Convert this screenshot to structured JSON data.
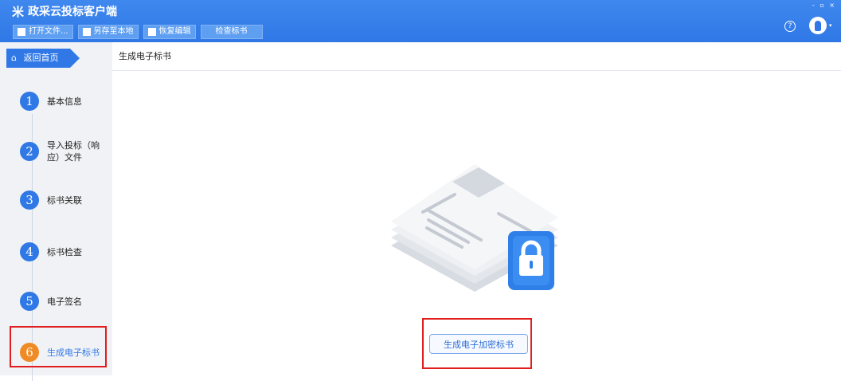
{
  "app": {
    "logo_glyph": "米",
    "title": "政采云投标客户端",
    "window_controls": "- ▫ ×",
    "help_glyph": "?",
    "avatar_caret": "▾"
  },
  "toolbar": {
    "open_label": "打开文件...",
    "save_local_label": "另存至本地",
    "restore_label": "恢复编辑",
    "check_label": "检查标书"
  },
  "sidebar": {
    "home_label": "返回首页",
    "steps": [
      {
        "num": "1",
        "label": "基本信息"
      },
      {
        "num": "2",
        "label": "导入投标（响应）文件"
      },
      {
        "num": "3",
        "label": "标书关联"
      },
      {
        "num": "4",
        "label": "标书检查"
      },
      {
        "num": "5",
        "label": "电子签名"
      },
      {
        "num": "6",
        "label": "生成电子标书"
      }
    ],
    "active_step": 6
  },
  "main": {
    "header_title": "生成电子标书",
    "generate_button_label": "生成电子加密标书"
  },
  "colors": {
    "accent": "#2f78e6",
    "active_step": "#f08a24",
    "highlight_border": "#e01e1e"
  }
}
